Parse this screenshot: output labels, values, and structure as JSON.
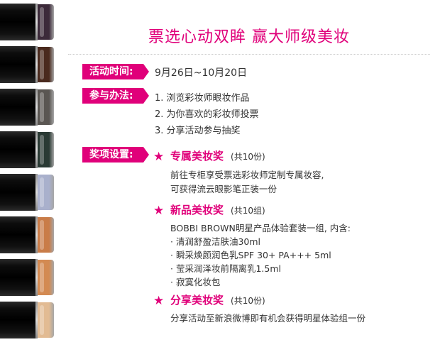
{
  "colors": {
    "accent": "#e0007a",
    "text": "#333333",
    "background": "#ffffff"
  },
  "strip": {
    "caps": [
      "#3c2a3a",
      "#4a2a1e",
      "#5a5652",
      "#2a3a34",
      "#a9b0cc",
      "#c97c48",
      "#d38a52",
      "#e2bb93"
    ]
  },
  "title": "票选心动双眸  赢大师级美妆",
  "time": {
    "label": "活动时间:",
    "value": "9月26日~10月20日"
  },
  "method": {
    "label": "参与办法:",
    "steps": [
      "1. 浏览彩妆师眼妆作品",
      "2. 为你喜欢的彩妆师投票",
      "3. 分享活动参与抽奖"
    ]
  },
  "prize": {
    "label": "奖项设置:",
    "star_icon": "★",
    "items": [
      {
        "name": "专属美妆奖",
        "count": "(共10份)",
        "lines": [
          "前往专柜享受票选彩妆师定制专属妆容,",
          "可获得流云眼影笔正装一份"
        ]
      },
      {
        "name": "新品美妆奖",
        "count": "(共10组)",
        "lines": [
          "BOBBI BROWN明星产品体验套装一组, 内含:",
          "· 清润舒盈洁肤油30ml",
          "· 瞬采焕颜润色乳SPF 30+ PA+++ 5ml",
          "· 莹采润泽妆前隔离乳1.5ml",
          "· 寂寞化妆包"
        ]
      },
      {
        "name": "分享美妆奖",
        "count": "(共10份)",
        "lines": [
          "分享活动至新浪微博即有机会获得明星体验组一份"
        ]
      }
    ]
  }
}
